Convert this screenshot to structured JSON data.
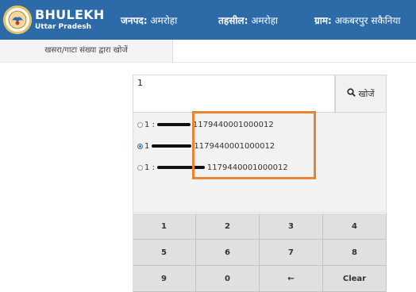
{
  "header": {
    "title": "BHULEKH",
    "subtitle": "Uttar Pradesh",
    "janpad_label": "जनपद:",
    "janpad_value": "अमरोहा",
    "tehsil_label": "तहसील:",
    "tehsil_value": "अमरोहा",
    "gram_label": "ग्राम:",
    "gram_value": "अकबरपुर सकैनिया"
  },
  "subnav": {
    "label": "खसरा/गाटा संख्या द्वारा खोजें"
  },
  "search": {
    "value": "1",
    "button_label": "खोजें"
  },
  "results": [
    {
      "prefix": "1 :",
      "code": "1179440001000012",
      "selected": false
    },
    {
      "prefix": "1",
      "code": "1179440001000012",
      "selected": true
    },
    {
      "prefix": "1 :",
      "code": "1179440001000012",
      "selected": false
    }
  ],
  "keypad": {
    "keys": [
      "1",
      "2",
      "3",
      "4",
      "5",
      "6",
      "7",
      "8",
      "9",
      "0",
      "←",
      "Clear"
    ]
  },
  "colors": {
    "header_bg": "#2c6aa8",
    "highlight": "#e88434",
    "radio_selected": "#2f6fc4"
  }
}
